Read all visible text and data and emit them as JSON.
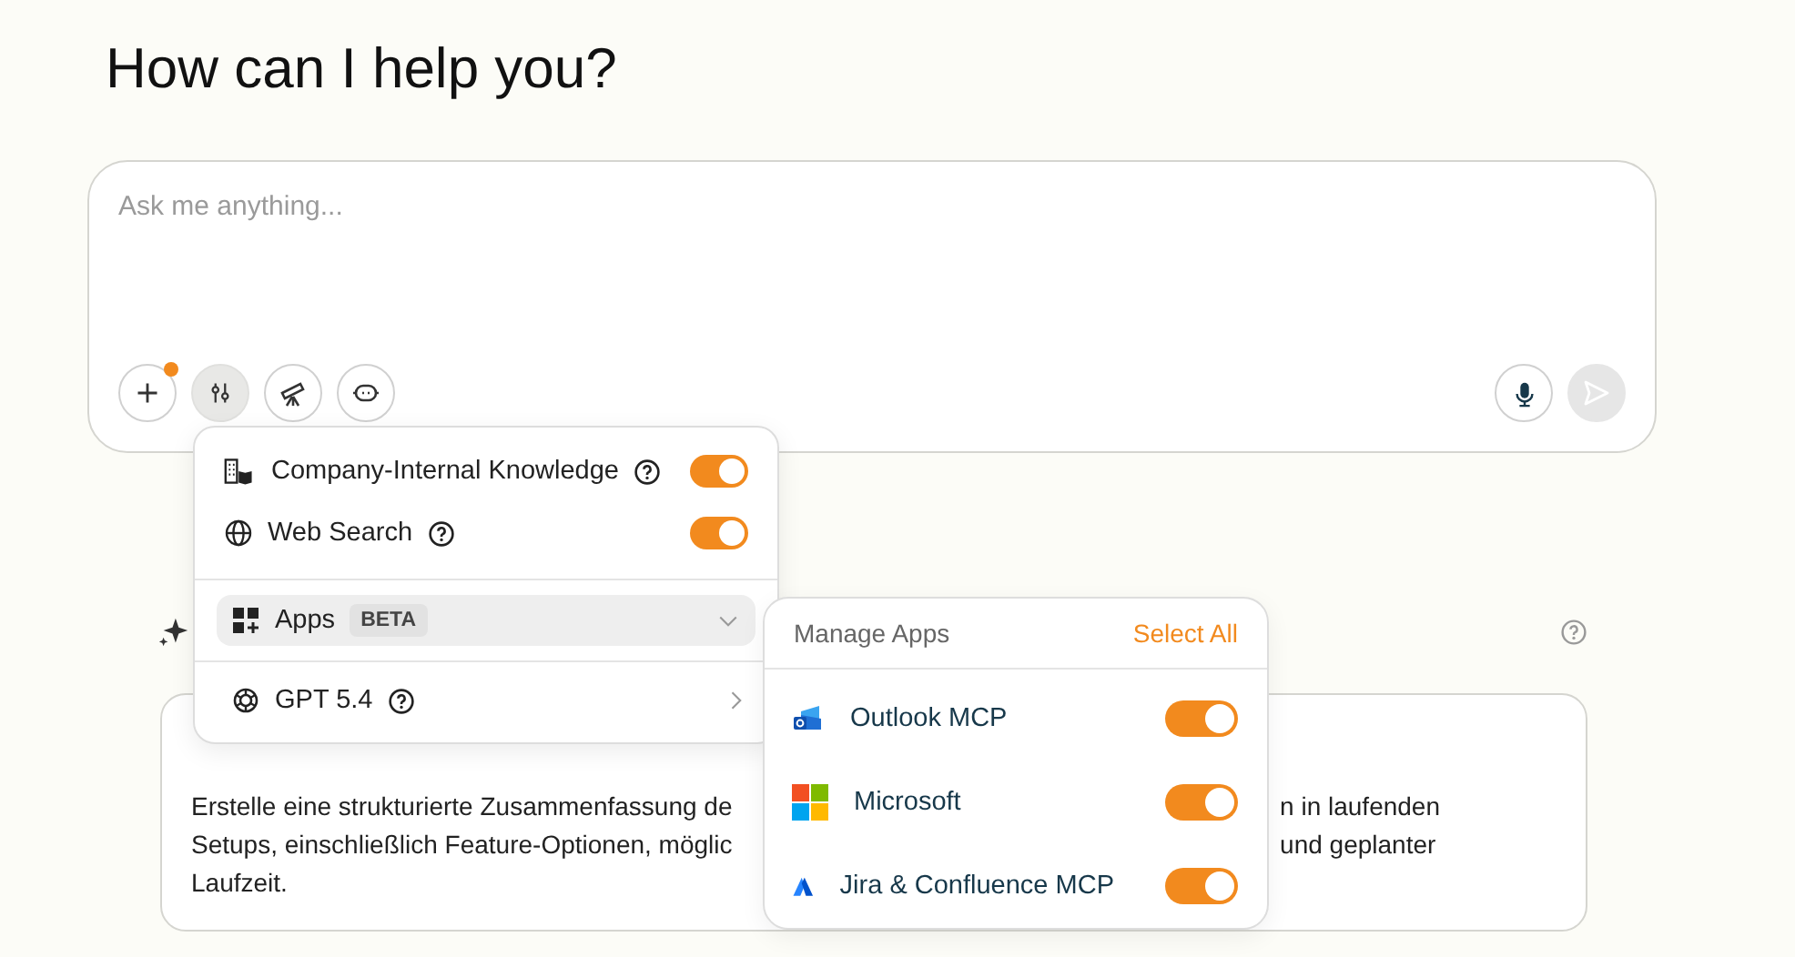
{
  "heading": "How can I help you?",
  "prompt": {
    "placeholder": "Ask me anything..."
  },
  "tools": [
    {
      "kind": "plus",
      "selected": false,
      "notification": true
    },
    {
      "kind": "sliders",
      "selected": true,
      "notification": false
    },
    {
      "kind": "telescope",
      "selected": false,
      "notification": false
    },
    {
      "kind": "robot",
      "selected": false,
      "notification": false
    }
  ],
  "actions": [
    {
      "kind": "mic",
      "disabled": false
    },
    {
      "kind": "send",
      "disabled": true
    }
  ],
  "tools_menu": {
    "sources": [
      {
        "kind": "company",
        "label": "Company-Internal Knowledge",
        "help": true,
        "on": true
      },
      {
        "kind": "web",
        "label": "Web Search",
        "help": true,
        "on": true
      }
    ],
    "apps": {
      "label": "Apps",
      "badge": "BETA",
      "expanded": true
    },
    "model": {
      "label": "GPT 5.4",
      "help": true
    }
  },
  "apps_menu": {
    "title": "Manage Apps",
    "select_all": "Select All",
    "apps": [
      {
        "kind": "outlook",
        "label": "Outlook MCP",
        "on": true
      },
      {
        "kind": "microsoft",
        "label": "Microsoft",
        "on": true
      },
      {
        "kind": "jira",
        "label": "Jira & Confluence MCP",
        "on": true
      }
    ]
  },
  "card": {
    "text_left": [
      "Erstelle eine strukturierte Zusammenfassung de",
      "Setups, einschließlich Feature-Optionen, möglic",
      "Laufzeit."
    ],
    "text_right": [
      "n in laufenden",
      "und geplanter"
    ]
  }
}
